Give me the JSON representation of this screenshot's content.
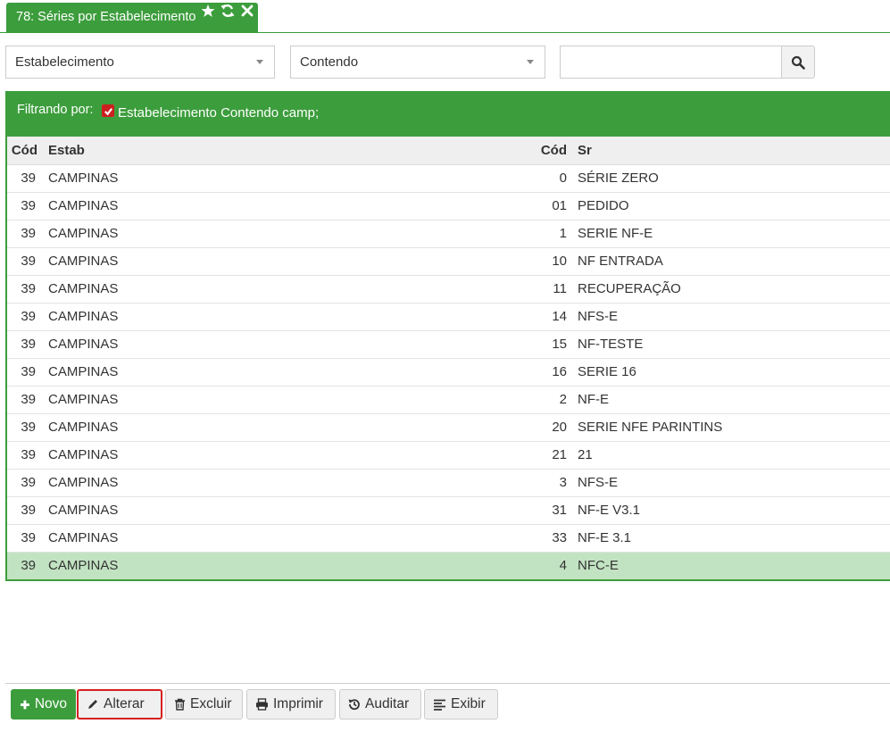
{
  "tab": {
    "title": "78: Séries por Estabelecimento",
    "icons": [
      "star-icon",
      "refresh-icon",
      "close-icon"
    ]
  },
  "filters": {
    "field_select": "Estabelecimento",
    "operator_select": "Contendo",
    "search_value": "",
    "search_icon": "search-icon"
  },
  "filter_bar": {
    "label": "Filtrando por:",
    "active_filter": "Estabelecimento Contendo camp;"
  },
  "table": {
    "headers": [
      "Cód",
      "Estab",
      "Cód",
      "Sr"
    ],
    "rows": [
      {
        "cod_estab": "39",
        "estab": "CAMPINAS",
        "cod_sr": "0",
        "sr": "SÉRIE ZERO"
      },
      {
        "cod_estab": "39",
        "estab": "CAMPINAS",
        "cod_sr": "01",
        "sr": "PEDIDO"
      },
      {
        "cod_estab": "39",
        "estab": "CAMPINAS",
        "cod_sr": "1",
        "sr": "SERIE NF-E"
      },
      {
        "cod_estab": "39",
        "estab": "CAMPINAS",
        "cod_sr": "10",
        "sr": "NF ENTRADA"
      },
      {
        "cod_estab": "39",
        "estab": "CAMPINAS",
        "cod_sr": "11",
        "sr": "RECUPERAÇÃO"
      },
      {
        "cod_estab": "39",
        "estab": "CAMPINAS",
        "cod_sr": "14",
        "sr": "NFS-E"
      },
      {
        "cod_estab": "39",
        "estab": "CAMPINAS",
        "cod_sr": "15",
        "sr": "NF-TESTE"
      },
      {
        "cod_estab": "39",
        "estab": "CAMPINAS",
        "cod_sr": "16",
        "sr": "SERIE 16"
      },
      {
        "cod_estab": "39",
        "estab": "CAMPINAS",
        "cod_sr": "2",
        "sr": "NF-E"
      },
      {
        "cod_estab": "39",
        "estab": "CAMPINAS",
        "cod_sr": "20",
        "sr": "SERIE NFE PARINTINS"
      },
      {
        "cod_estab": "39",
        "estab": "CAMPINAS",
        "cod_sr": "21",
        "sr": "21"
      },
      {
        "cod_estab": "39",
        "estab": "CAMPINAS",
        "cod_sr": "3",
        "sr": "NFS-E"
      },
      {
        "cod_estab": "39",
        "estab": "CAMPINAS",
        "cod_sr": "31",
        "sr": "NF-E V3.1"
      },
      {
        "cod_estab": "39",
        "estab": "CAMPINAS",
        "cod_sr": "33",
        "sr": "NF-E 3.1"
      },
      {
        "cod_estab": "39",
        "estab": "CAMPINAS",
        "cod_sr": "4",
        "sr": "NFC-E"
      }
    ],
    "selected_row_index": 14
  },
  "toolbar": {
    "novo_label": "Novo",
    "alterar_label": "Alterar",
    "excluir_label": "Excluir",
    "imprimir_label": "Imprimir",
    "auditar_label": "Auditar",
    "exibir_label": "Exibir"
  },
  "colors": {
    "accent_green": "#3c9d3c",
    "selected_row": "#c2e3c2",
    "highlight_red": "#d61f1f"
  }
}
